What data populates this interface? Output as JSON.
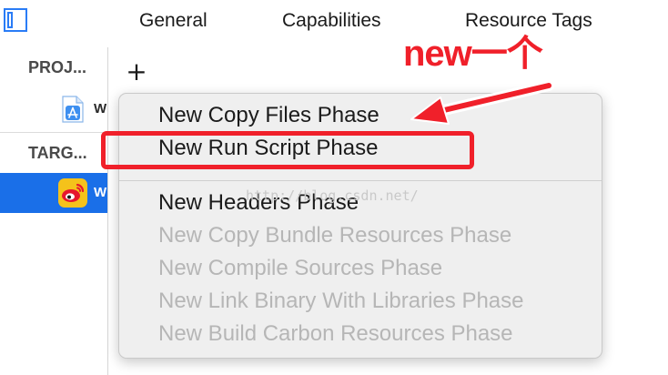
{
  "tabs": [
    {
      "label": "General"
    },
    {
      "label": "Capabilities"
    },
    {
      "label": "Resource Tags"
    }
  ],
  "sidebar": {
    "project_header": "PROJ...",
    "project_item": "W",
    "targets_header": "TARG...",
    "target_item": "W"
  },
  "content": {
    "add_label": "+"
  },
  "menu": {
    "items": [
      {
        "label": "New Copy Files Phase",
        "enabled": true
      },
      {
        "label": "New Run Script Phase",
        "enabled": true
      },
      {
        "label": "New Headers Phase",
        "enabled": true
      },
      {
        "label": "New Copy Bundle Resources Phase",
        "enabled": false
      },
      {
        "label": "New Compile Sources Phase",
        "enabled": false
      },
      {
        "label": "New Link Binary With Libraries Phase",
        "enabled": false
      },
      {
        "label": "New Build Carbon Resources Phase",
        "enabled": false
      }
    ]
  },
  "watermark": "http://blog.csdn.net/",
  "annotation": {
    "text": "new一个",
    "color": "#f0202a"
  },
  "colors": {
    "accent": "#2a7cf6",
    "selection": "#1a6fe8"
  }
}
